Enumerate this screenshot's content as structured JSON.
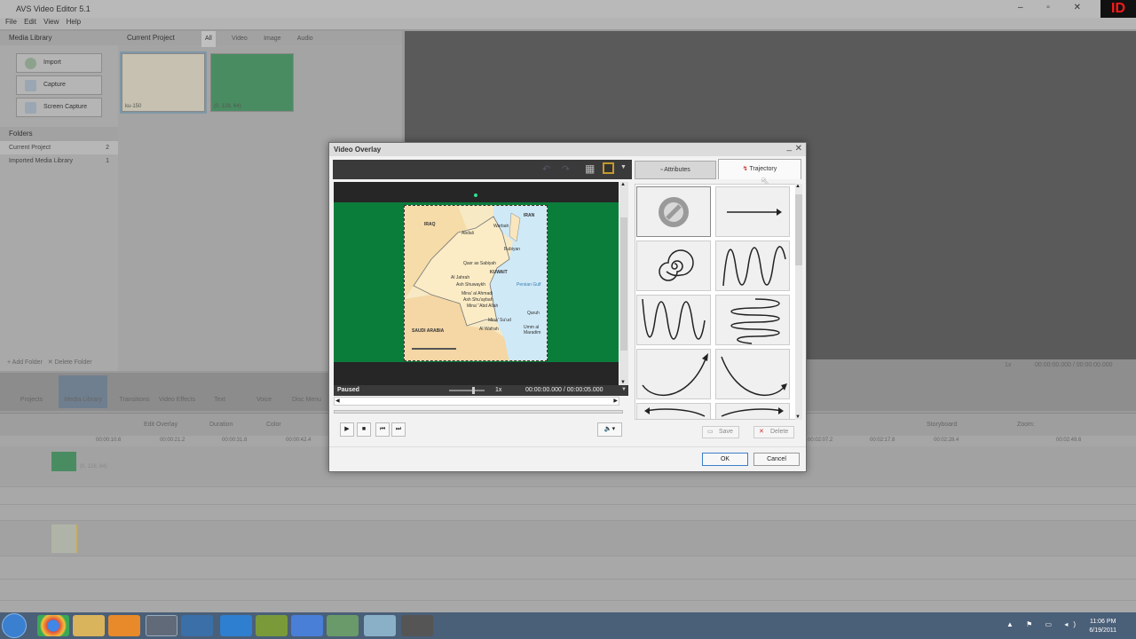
{
  "app": {
    "title": "AVS Video Editor 5.1",
    "corner_tag": "ID",
    "menu": [
      "File",
      "Edit",
      "View",
      "Help"
    ]
  },
  "media_library": {
    "title": "Media Library",
    "buttons": [
      "Import",
      "Capture",
      "Screen Capture"
    ],
    "folders_title": "Folders",
    "folders": [
      {
        "name": "Current Project",
        "count": "2"
      },
      {
        "name": "Imported Media Library",
        "count": "1"
      }
    ],
    "add_folder": "Add Folder",
    "delete_folder": "Delete Folder"
  },
  "current_project": {
    "title": "Current Project",
    "tabs": [
      "All",
      "Video",
      "Image",
      "Audio"
    ],
    "thumbs": [
      {
        "caption": "ku-150"
      },
      {
        "caption": "(0, 128, 64)"
      }
    ]
  },
  "toolbar": {
    "items": [
      "Projects",
      "Media Library",
      "Transitions",
      "Video Effects",
      "Text",
      "Voice",
      "Disc Menu"
    ]
  },
  "timeline": {
    "actions": [
      "Edit Overlay",
      "Duration",
      "Color"
    ],
    "view_mode": "Storyboard",
    "zoom_label": "Zoom:",
    "ruler": [
      "00:00:10.6",
      "00:00:21.2",
      "00:00:31.8",
      "00:00:42.4",
      "00:02:07.2",
      "00:02:17.8",
      "00:02:28.4",
      "00:02:49.6"
    ],
    "clip_label": "(0, 128, 64)",
    "preview_speed": "1x",
    "preview_time": "00:00:00.000 / 00:00:00.000"
  },
  "dialog": {
    "title": "Video Overlay",
    "tabs": {
      "attributes": "Attributes",
      "trajectory": "Trajectory"
    },
    "status": "Paused",
    "speed": "1x",
    "time": "00:00:00.000  /  00:00:05.000",
    "save": "Save",
    "delete": "Delete",
    "ok": "OK",
    "cancel": "Cancel",
    "map_labels": [
      "IRAN",
      "IRAQ",
      "Abdali",
      "Warbah",
      "Bubiyan",
      "Qasr as Sabiyah",
      "KUWAIT",
      "Al Jahrah",
      "Ash Shuwaykh",
      "Persian Gulf",
      "Mina' al Ahmadi",
      "Ash Shu'aybah",
      "Mina' 'Abd Allah",
      "Mina' Su'ud",
      "Al Wafrah",
      "Qaruh",
      "Umm al Maradim",
      "SAUDI ARABIA"
    ],
    "trajectories": [
      "none",
      "straight-line",
      "spiral",
      "wave-vertical",
      "zigzag",
      "loop-horizontal",
      "curve-up",
      "curve-down",
      "arrow-left",
      "arrow-right"
    ]
  },
  "taskbar": {
    "time": "11:06 PM",
    "date": "6/19/2011"
  }
}
